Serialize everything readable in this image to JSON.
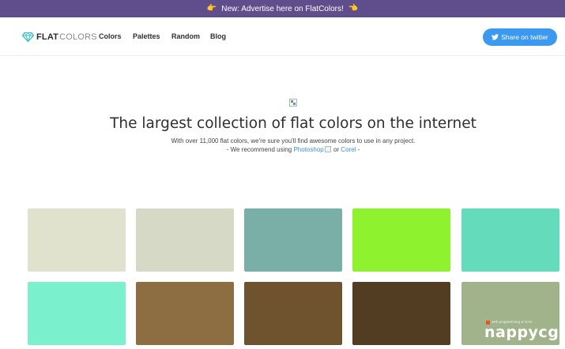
{
  "announcement": {
    "text": "New: Advertise here on FlatColors!",
    "left_emoji": "👉",
    "right_emoji": "👈"
  },
  "brand": {
    "bold": "FLAT",
    "light": "COLORS",
    "icon": "diamond-icon",
    "icon_color": "#3ec0c5"
  },
  "nav": {
    "colors": "Colors",
    "palettes": "Palettes",
    "random": "Random",
    "blog": "Blog"
  },
  "twitter_button": {
    "label": "Share on twitter",
    "icon": "twitter-bird-icon",
    "color": "#3b99f0"
  },
  "hero": {
    "title": "The largest collection of flat colors on the internet",
    "subtitle": "With over 11,000 flat colors, we're sure you'll find awesome colors to use in any project.",
    "recommend_prefix": "- We recommend using ",
    "photoshop": "Photoshop",
    "or": " or ",
    "corel": "Corel",
    "recommend_suffix": " -"
  },
  "swatches": [
    {
      "color": "#e0e2cd"
    },
    {
      "color": "#d6d9c6"
    },
    {
      "color": "#7aafa8"
    },
    {
      "color": "#8ef22f"
    },
    {
      "color": "#64dcbb"
    },
    {
      "color": "#7af0cc"
    },
    {
      "color": "#8c6e42"
    },
    {
      "color": "#6e532e"
    },
    {
      "color": "#523d22"
    },
    {
      "color": "#a0b38a"
    }
  ],
  "watermark": {
    "text": "nappycgi",
    "tagline": "web programming & more"
  }
}
